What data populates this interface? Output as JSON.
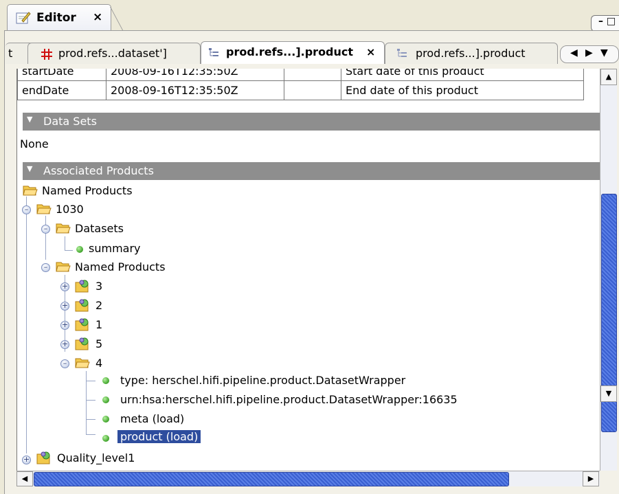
{
  "editor": {
    "title": "Editor",
    "close_glyph": "×",
    "minimize_glyph": "– □"
  },
  "doc_tabs": [
    {
      "label": "t",
      "icon": "none"
    },
    {
      "label": "prod.refs...dataset']",
      "icon": "red-cross-icon"
    },
    {
      "label": "prod.refs...].product",
      "icon": "tree-icon",
      "close": "×",
      "active": true
    },
    {
      "label": "prod.refs...].product",
      "icon": "tree-icon"
    }
  ],
  "tab_nav": {
    "left": "◀",
    "right": "▶",
    "menu": "▼"
  },
  "properties": {
    "rows": [
      {
        "name": "startDate",
        "value": "2008-09-16T12:35:50Z",
        "unit": "",
        "description": "Start date of this product"
      },
      {
        "name": "endDate",
        "value": "2008-09-16T12:35:50Z",
        "unit": "",
        "description": "End date of this product"
      }
    ]
  },
  "sections": {
    "datasets": {
      "title": "Data Sets",
      "content": "None"
    },
    "associated": {
      "title": "Associated Products"
    }
  },
  "tree": {
    "root": "Named Products",
    "n1030": "1030",
    "datasets": "Datasets",
    "summary": "summary",
    "named_products": "Named Products",
    "children": [
      "3",
      "2",
      "1",
      "5",
      "4"
    ],
    "leaves": [
      "type: herschel.hifi.pipeline.product.DatasetWrapper",
      "urn:hsa:herschel.hifi.pipeline.product.DatasetWrapper:16635",
      "meta (load)",
      "product (load)"
    ],
    "quality": "Quality_level1"
  },
  "colors": {
    "selection": "#2e4d9e",
    "section_header": "#8e8e8e",
    "scroll_thumb": "#4a6fe0",
    "leaf_dot": "#3fa32a"
  }
}
